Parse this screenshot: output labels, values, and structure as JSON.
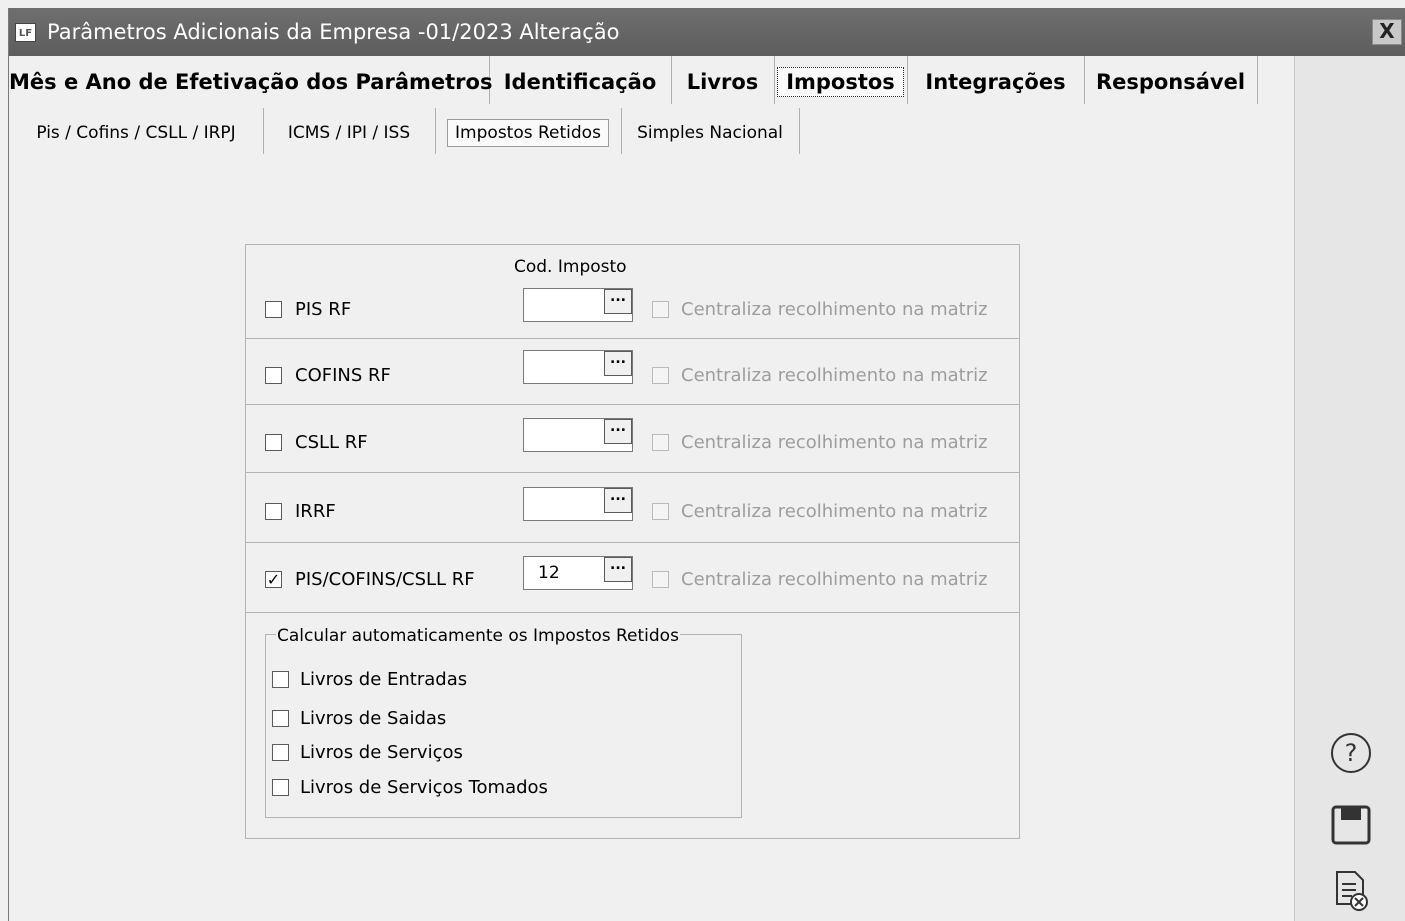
{
  "window": {
    "title": "Parâmetros Adicionais da Empresa -01/2023 Alteração",
    "app_icon_text": "LF",
    "close_label": "X"
  },
  "tabs_main": [
    {
      "label": "Mês e Ano de Efetivação dos Parâmetros",
      "active": false
    },
    {
      "label": "Identificação",
      "active": false
    },
    {
      "label": "Livros",
      "active": false
    },
    {
      "label": "Impostos",
      "active": true
    },
    {
      "label": "Integrações",
      "active": false
    },
    {
      "label": "Responsável",
      "active": false
    }
  ],
  "tabs_sub": [
    {
      "label": "Pis / Cofins / CSLL / IRPJ",
      "active": false
    },
    {
      "label": "ICMS / IPI / ISS",
      "active": false
    },
    {
      "label": "Impostos Retidos",
      "active": true
    },
    {
      "label": "Simples Nacional",
      "active": false
    }
  ],
  "taxes": {
    "column_header": "Cod. Imposto",
    "rows": [
      {
        "label": "PIS RF",
        "checked": false,
        "code": "",
        "central_label": "Centraliza recolhimento na matriz",
        "central_checked": false
      },
      {
        "label": "COFINS RF",
        "checked": false,
        "code": "",
        "central_label": "Centraliza recolhimento na matriz",
        "central_checked": false
      },
      {
        "label": "CSLL RF",
        "checked": false,
        "code": "",
        "central_label": "Centraliza recolhimento na matriz",
        "central_checked": false
      },
      {
        "label": "IRRF",
        "checked": false,
        "code": "",
        "central_label": "Centraliza recolhimento na matriz",
        "central_checked": false
      },
      {
        "label": "PIS/COFINS/CSLL RF",
        "checked": true,
        "code": "12",
        "central_label": "Centraliza recolhimento na matriz",
        "central_checked": false
      }
    ],
    "lookup_button_label": "..."
  },
  "auto_calc": {
    "title": "Calcular automaticamente os Impostos Retidos",
    "options": [
      {
        "label": "Livros de Entradas",
        "checked": false
      },
      {
        "label": "Livros de Saidas",
        "checked": false
      },
      {
        "label": "Livros de Serviços",
        "checked": false
      },
      {
        "label": "Livros de Serviços Tomados",
        "checked": false
      }
    ]
  },
  "side_actions": {
    "help_icon": "help-icon",
    "save_icon": "save-icon",
    "cancel_icon": "cancel-document-icon"
  }
}
